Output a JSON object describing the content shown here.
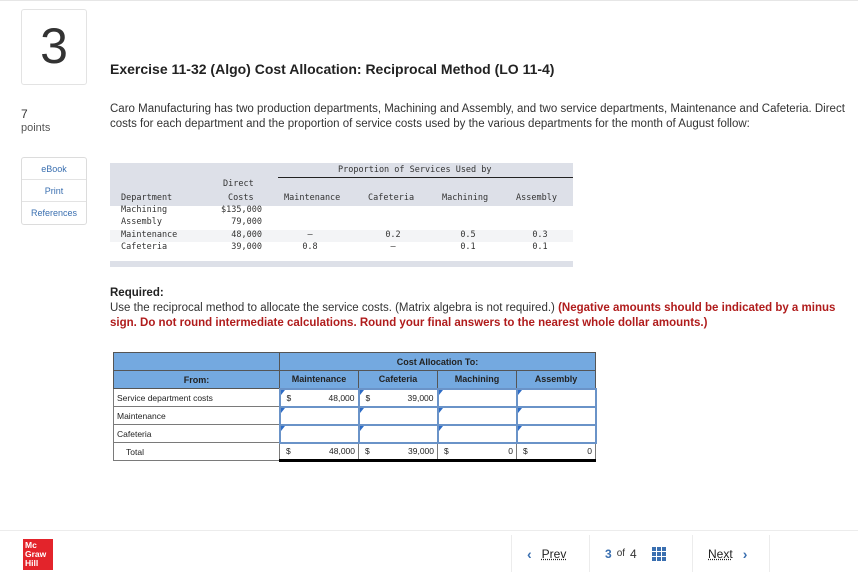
{
  "question": {
    "number": "3",
    "title": "Exercise 11-32 (Algo) Cost Allocation: Reciprocal Method (LO 11-4)",
    "points_value": "7",
    "points_label": "points",
    "intro": "Caro Manufacturing has two production departments, Machining and Assembly, and two service departments, Maintenance and Cafeteria. Direct costs for each department and the proportion of service costs used by the various departments for the month of August follow:"
  },
  "side_buttons": [
    "eBook",
    "Print",
    "References"
  ],
  "data_table": {
    "group_header": "Proportion of Services Used by",
    "headers": {
      "department": "Department",
      "direct_costs_line1": "Direct",
      "direct_costs_line2": "Costs",
      "maintenance": "Maintenance",
      "cafeteria": "Cafeteria",
      "machining": "Machining",
      "assembly": "Assembly"
    },
    "rows": [
      {
        "department": "Machining",
        "direct_costs": "$135,000",
        "maintenance": "",
        "cafeteria": "",
        "machining": "",
        "assembly": ""
      },
      {
        "department": "Assembly",
        "direct_costs": "79,000",
        "maintenance": "",
        "cafeteria": "",
        "machining": "",
        "assembly": ""
      },
      {
        "department": "Maintenance",
        "direct_costs": "48,000",
        "maintenance": "–",
        "cafeteria": "0.2",
        "machining": "0.5",
        "assembly": "0.3"
      },
      {
        "department": "Cafeteria",
        "direct_costs": "39,000",
        "maintenance": "0.8",
        "cafeteria": "–",
        "machining": "0.1",
        "assembly": "0.1"
      }
    ]
  },
  "required": {
    "label": "Required:",
    "text": "Use the reciprocal method to allocate the service costs. (Matrix algebra is not required.) ",
    "emphasis": "(Negative amounts should be indicated by a minus sign. Do not round intermediate calculations. Round your final answers to the nearest whole dollar amounts.)"
  },
  "answer_table": {
    "group_header": "Cost Allocation To:",
    "from_label": "From:",
    "columns": [
      "Maintenance",
      "Cafeteria",
      "Machining",
      "Assembly"
    ],
    "rows": [
      {
        "label": "Service department costs",
        "cells": [
          {
            "currency": "$",
            "value": "48,000"
          },
          {
            "currency": "$",
            "value": "39,000"
          },
          {
            "currency": "",
            "value": ""
          },
          {
            "currency": "",
            "value": ""
          }
        ]
      },
      {
        "label": "Maintenance",
        "cells": [
          {
            "currency": "",
            "value": ""
          },
          {
            "currency": "",
            "value": ""
          },
          {
            "currency": "",
            "value": ""
          },
          {
            "currency": "",
            "value": ""
          }
        ]
      },
      {
        "label": "Cafeteria",
        "cells": [
          {
            "currency": "",
            "value": ""
          },
          {
            "currency": "",
            "value": ""
          },
          {
            "currency": "",
            "value": ""
          },
          {
            "currency": "",
            "value": ""
          }
        ]
      }
    ],
    "total": {
      "label": "Total",
      "cells": [
        {
          "currency": "$",
          "value": "48,000"
        },
        {
          "currency": "$",
          "value": "39,000"
        },
        {
          "currency": "$",
          "value": "0"
        },
        {
          "currency": "$",
          "value": "0"
        }
      ]
    }
  },
  "footer": {
    "logo": [
      "Mc",
      "Graw",
      "Hill"
    ],
    "prev_label": "Prev",
    "next_label": "Next",
    "current_page": "3",
    "of_label": "of",
    "total_pages": "4"
  },
  "colors": {
    "accent_blue": "#3a6fb0",
    "table_header_blue": "#74a9e0",
    "warning_red": "#b01c1c",
    "logo_red": "#e3242b"
  }
}
